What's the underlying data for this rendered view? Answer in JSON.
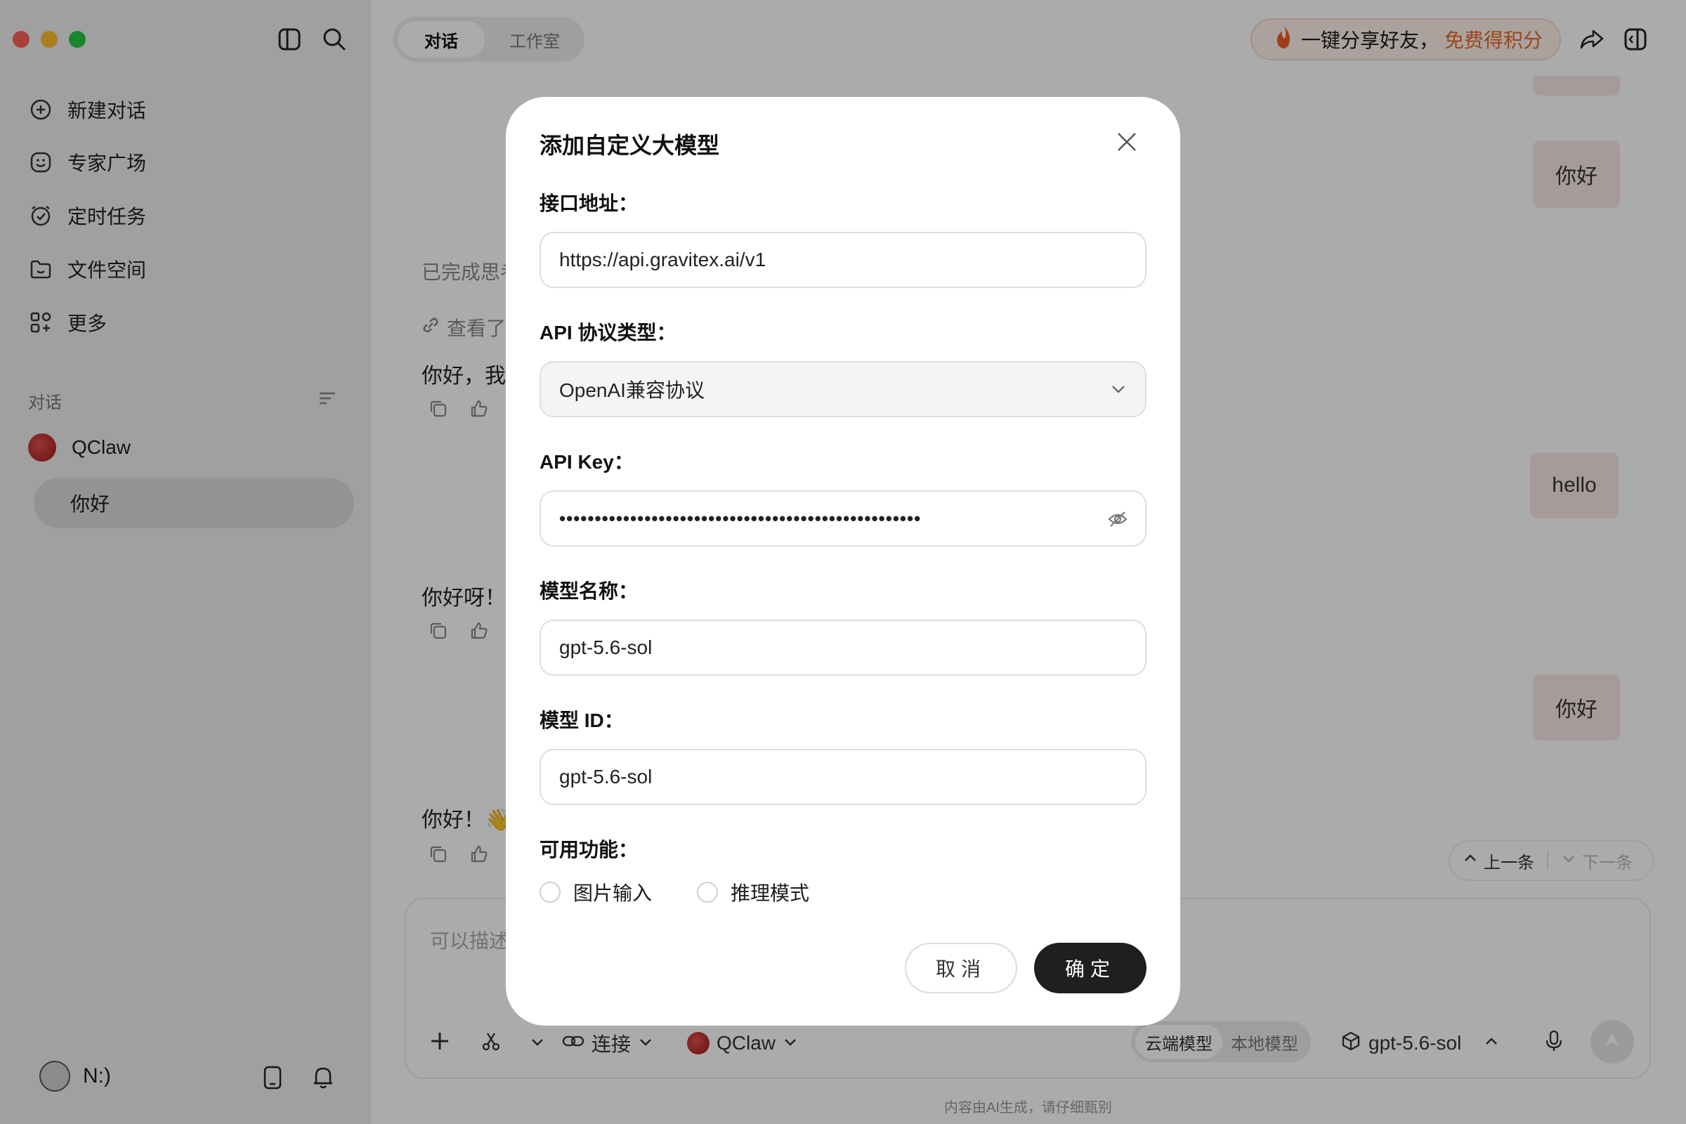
{
  "sidebar": {
    "nav_items": [
      {
        "label": "新建对话",
        "icon": "plus-circle-icon"
      },
      {
        "label": "专家广场",
        "icon": "smile-face-icon"
      },
      {
        "label": "定时任务",
        "icon": "alarm-clock-icon"
      },
      {
        "label": "文件空间",
        "icon": "folder-icon"
      },
      {
        "label": "更多",
        "icon": "apps-grid-icon"
      }
    ],
    "section_label": "对话",
    "conversation_group": "QClaw",
    "active_conversation": "你好",
    "user_name": "N:)"
  },
  "header": {
    "tabs": [
      "对话",
      "工作室"
    ],
    "share_text": "一键分享好友，",
    "share_promo": "免费得积分",
    "promo_color": "#e4682a"
  },
  "chat": {
    "thinking_done": "已完成思考",
    "view_text": "查看了",
    "messages": [
      {
        "role": "user",
        "text": "你好"
      },
      {
        "role": "assistant",
        "text": "你好，我"
      },
      {
        "role": "user",
        "text": "hello"
      },
      {
        "role": "assistant",
        "text": "你好呀！"
      },
      {
        "role": "user",
        "text": "你好"
      },
      {
        "role": "assistant",
        "text": "你好！👋"
      }
    ],
    "prev_label": "上一条",
    "next_label": "下一条"
  },
  "composer": {
    "placeholder": "可以描述",
    "connect_label": "连接",
    "agent_label": "QClaw",
    "model_tabs": [
      "云端模型",
      "本地模型"
    ],
    "model_name": "gpt-5.6-sol",
    "footer_note": "内容由AI生成，请仔细甄别"
  },
  "dialog": {
    "title": "添加自定义大模型",
    "endpoint_label": "接口地址：",
    "endpoint_value": "https://api.gravitex.ai/v1",
    "protocol_label": "API 协议类型：",
    "protocol_value": "OpenAI兼容协议",
    "api_key_label": "API Key：",
    "api_key_masked": "•••••••••••••••••••••••••••••••••••••••••••••••••••",
    "model_name_label": "模型名称：",
    "model_name_value": "gpt-5.6-sol",
    "model_id_label": "模型 ID：",
    "model_id_value": "gpt-5.6-sol",
    "features_label": "可用功能：",
    "features": [
      {
        "label": "图片输入",
        "checked": false
      },
      {
        "label": "推理模式",
        "checked": false
      }
    ],
    "cancel_label": "取消",
    "confirm_label": "确定"
  }
}
